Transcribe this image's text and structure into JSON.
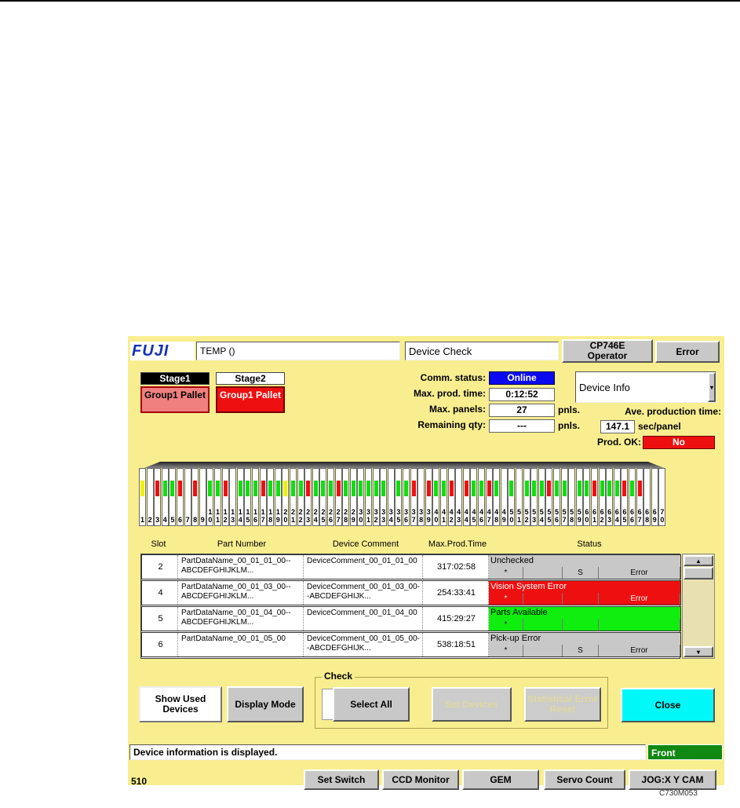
{
  "header": {
    "logo": "FUJI",
    "temp": "TEMP ()",
    "screen": "Device Check",
    "model": "CP746E Operator",
    "error_btn": "Error"
  },
  "stages": {
    "stage1": "Stage1",
    "stage2": "Stage2",
    "group1_a": "Group1 Pallet",
    "group1_b": "Group1 Pallet"
  },
  "info": {
    "comm_label": "Comm. status:",
    "comm_value": "Online",
    "max_time_label": "Max. prod. time:",
    "max_time_value": "0:12:52",
    "max_panels_label": "Max. panels:",
    "max_panels_value": "27",
    "pnls1": "pnls.",
    "remaining_label": "Remaining qty:",
    "remaining_value": "---",
    "pnls2": "pnls.",
    "ave_label": "Ave. production time:",
    "ave_value": "147.1",
    "ave_unit": "sec/panel",
    "prod_ok_label": "Prod. OK:",
    "prod_ok_value": "No",
    "dropdown": "Device Info"
  },
  "slot_colors": {
    "red": "#ee1010",
    "green": "#10dd10",
    "yellow": "#f0f000"
  },
  "slots": [
    {
      "n": "1",
      "c": "yellow"
    },
    {
      "n": "2",
      "c": ""
    },
    {
      "n": "3",
      "c": "red"
    },
    {
      "n": "4",
      "c": "green"
    },
    {
      "n": "5",
      "c": "green"
    },
    {
      "n": "6",
      "c": "red"
    },
    {
      "n": "7",
      "c": ""
    },
    {
      "n": "8",
      "c": "red"
    },
    {
      "n": "9",
      "c": ""
    },
    {
      "n": "10",
      "c": "green"
    },
    {
      "n": "11",
      "c": "green"
    },
    {
      "n": "12",
      "c": "red"
    },
    {
      "n": "13",
      "c": ""
    },
    {
      "n": "14",
      "c": "green"
    },
    {
      "n": "15",
      "c": "green"
    },
    {
      "n": "16",
      "c": "green"
    },
    {
      "n": "17",
      "c": "red"
    },
    {
      "n": "18",
      "c": "green"
    },
    {
      "n": "19",
      "c": "green"
    },
    {
      "n": "20",
      "c": "yellow"
    },
    {
      "n": "21",
      "c": "green"
    },
    {
      "n": "22",
      "c": "green"
    },
    {
      "n": "23",
      "c": "red"
    },
    {
      "n": "24",
      "c": "green"
    },
    {
      "n": "25",
      "c": "green"
    },
    {
      "n": "26",
      "c": "green"
    },
    {
      "n": "27",
      "c": "red"
    },
    {
      "n": "28",
      "c": "green"
    },
    {
      "n": "29",
      "c": "green"
    },
    {
      "n": "30",
      "c": "green"
    },
    {
      "n": "31",
      "c": "green"
    },
    {
      "n": "32",
      "c": "green"
    },
    {
      "n": "33",
      "c": "green"
    },
    {
      "n": "34",
      "c": ""
    },
    {
      "n": "35",
      "c": "green"
    },
    {
      "n": "36",
      "c": "green"
    },
    {
      "n": "37",
      "c": "red"
    },
    {
      "n": "38",
      "c": ""
    },
    {
      "n": "39",
      "c": "red"
    },
    {
      "n": "40",
      "c": "green"
    },
    {
      "n": "41",
      "c": "green"
    },
    {
      "n": "42",
      "c": "red"
    },
    {
      "n": "43",
      "c": ""
    },
    {
      "n": "44",
      "c": "red"
    },
    {
      "n": "45",
      "c": "green"
    },
    {
      "n": "46",
      "c": "green"
    },
    {
      "n": "47",
      "c": "red"
    },
    {
      "n": "48",
      "c": "green"
    },
    {
      "n": "49",
      "c": ""
    },
    {
      "n": "50",
      "c": "green"
    },
    {
      "n": "51",
      "c": ""
    },
    {
      "n": "52",
      "c": "green"
    },
    {
      "n": "53",
      "c": "green"
    },
    {
      "n": "54",
      "c": "green"
    },
    {
      "n": "55",
      "c": "red"
    },
    {
      "n": "56",
      "c": "green"
    },
    {
      "n": "57",
      "c": "green"
    },
    {
      "n": "58",
      "c": ""
    },
    {
      "n": "59",
      "c": "green"
    },
    {
      "n": "60",
      "c": "green"
    },
    {
      "n": "61",
      "c": "red"
    },
    {
      "n": "62",
      "c": "green"
    },
    {
      "n": "63",
      "c": "green"
    },
    {
      "n": "64",
      "c": "green"
    },
    {
      "n": "65",
      "c": "red"
    },
    {
      "n": "66",
      "c": "green"
    },
    {
      "n": "67",
      "c": "red"
    },
    {
      "n": "68",
      "c": ""
    },
    {
      "n": "69",
      "c": ""
    },
    {
      "n": "70",
      "c": ""
    }
  ],
  "table": {
    "headers": {
      "slot": "Slot",
      "part": "Part Number",
      "comment": "Device Comment",
      "max": "Max.Prod.Time",
      "status": "Status"
    },
    "rows": [
      {
        "slot": "2",
        "part": "PartDataName_00_01_01_00--ABCDEFGHIJKLM...",
        "comment": "DeviceComment_00_01_01_00",
        "max": "317:02:58",
        "status": "Unchecked",
        "color": "#c8c8c8",
        "sub": [
          "*",
          "",
          "S",
          "Error"
        ]
      },
      {
        "slot": "4",
        "part": "PartDataName_00_01_03_00--ABCDEFGHIJKLM...",
        "comment": "DeviceComment_00_01_03_00--ABCDEFGHIJK...",
        "max": "254:33:41",
        "status": "Vision System Error",
        "color": "#ee1010",
        "sub": [
          "*",
          "",
          "",
          "Error"
        ]
      },
      {
        "slot": "5",
        "part": "PartDataName_00_01_04_00--ABCDEFGHIJKLM...",
        "comment": "DeviceComment_00_01_04_00",
        "max": "415:29:27",
        "status": "Parts Available",
        "color": "#10ee10",
        "sub": [
          "*",
          "",
          "",
          ""
        ]
      },
      {
        "slot": "6",
        "part": "PartDataName_00_01_05_00",
        "comment": "DeviceComment_00_01_05_00--ABCDEFGHIJK...",
        "max": "538:18:51",
        "status": "Pick-up Error",
        "color": "#c8c8c8",
        "sub": [
          "*",
          "",
          "S",
          "Error"
        ]
      }
    ]
  },
  "buttons": {
    "show_used": "Show Used Devices",
    "display_mode": "Display Mode",
    "check_title": "Check",
    "select_all": "Select All",
    "set_devices": "Set Devices",
    "stat_reset": "Statistical Error Reset",
    "close": "Close"
  },
  "status_bar": {
    "message": "Device information  is displayed.",
    "side": "Front"
  },
  "toolbar": {
    "code": "510",
    "set_switch": "Set Switch",
    "ccd": "CCD Monitor",
    "gem": "GEM",
    "servo": "Servo Count",
    "jog": "JOG:X Y CAM"
  },
  "figure_code": "C730M053"
}
